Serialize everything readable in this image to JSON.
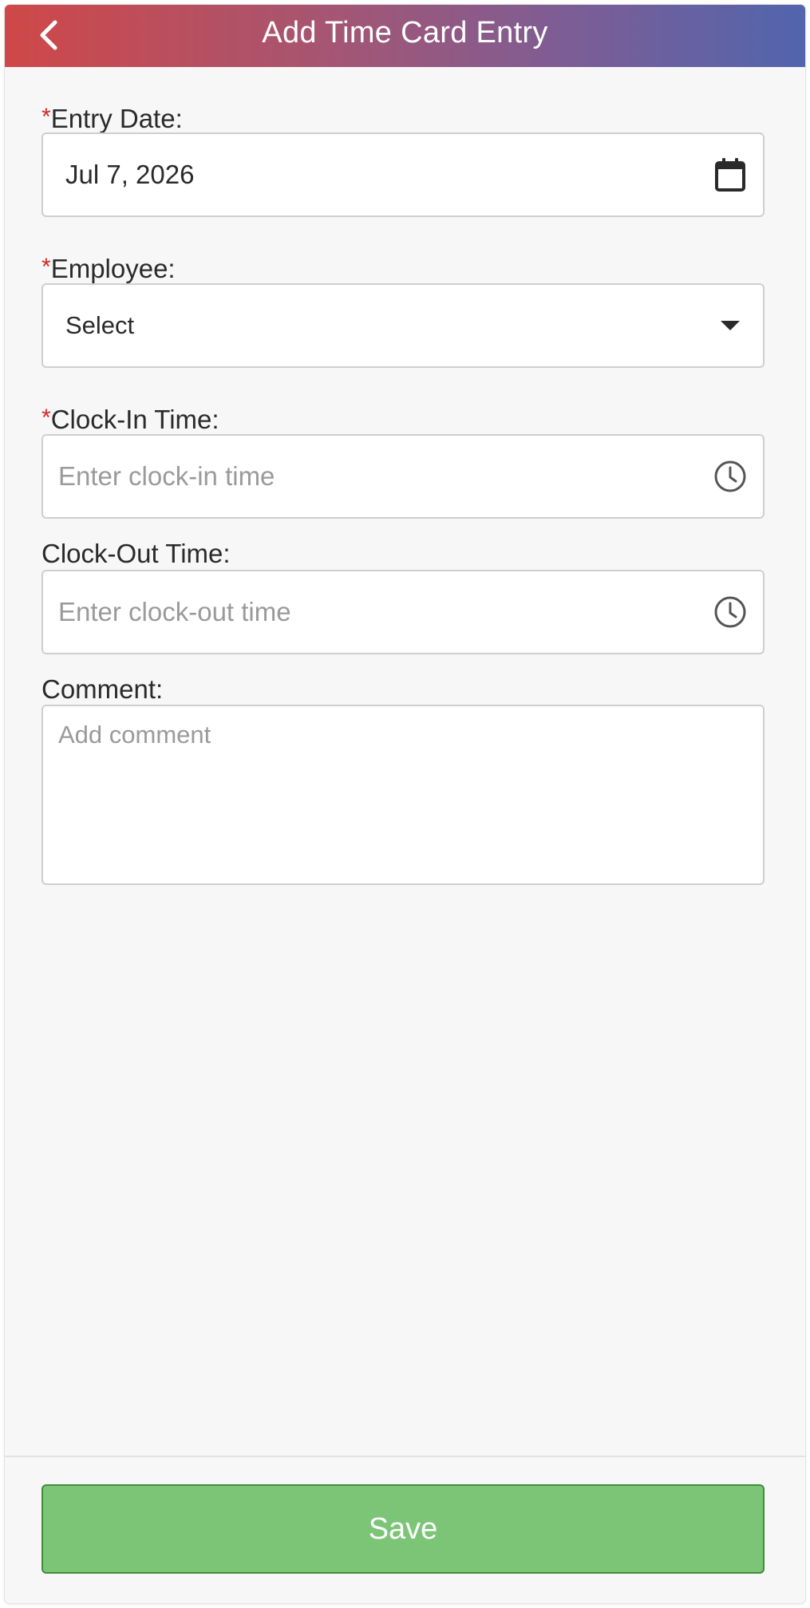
{
  "header": {
    "title": "Add Time Card Entry",
    "back_icon": "chevron-left-icon",
    "gradient_start": "#cf4848",
    "gradient_end": "#5165ad"
  },
  "form": {
    "required_marker": "*",
    "required_color": "#d62828",
    "entry_date": {
      "label": "Entry Date:",
      "value": "Jul 7, 2026",
      "icon": "calendar-icon"
    },
    "employee": {
      "label": "Employee:",
      "selected": "Select",
      "icon": "caret-down-icon"
    },
    "clock_in": {
      "label": "Clock-In Time:",
      "placeholder": "Enter clock-in time",
      "icon": "clock-icon"
    },
    "clock_out": {
      "label": "Clock-Out Time:",
      "placeholder": "Enter clock-out time",
      "icon": "clock-icon"
    },
    "comment": {
      "label": "Comment:",
      "placeholder": "Add comment"
    }
  },
  "footer": {
    "save_label": "Save",
    "save_color": "#7cc576"
  }
}
